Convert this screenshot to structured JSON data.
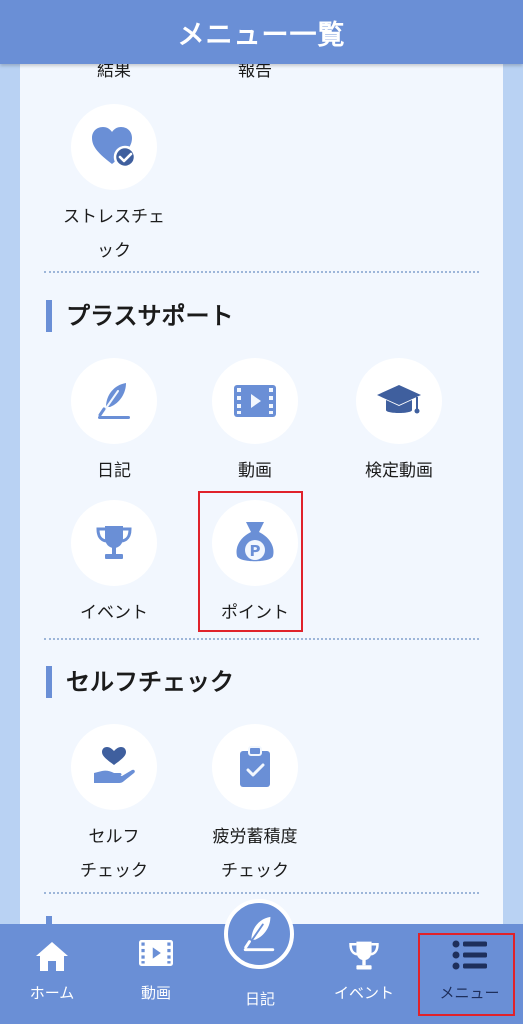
{
  "header": {
    "title": "メニュー一覧"
  },
  "top_partial": {
    "items": [
      "結果",
      "報告"
    ]
  },
  "stress": {
    "label": "ストレスチェ\nック"
  },
  "sections": [
    {
      "title": "プラスサポート",
      "items": [
        {
          "label": "日記",
          "icon": "feather-pen-icon"
        },
        {
          "label": "動画",
          "icon": "film-icon"
        },
        {
          "label": "検定動画",
          "icon": "graduation-cap-icon"
        },
        {
          "label": "イベント",
          "icon": "trophy-icon"
        },
        {
          "label": "ポイント",
          "icon": "money-bag-icon"
        }
      ]
    },
    {
      "title": "セルフチェック",
      "items": [
        {
          "label": "セルフ\nチェック",
          "icon": "heart-hand-icon"
        },
        {
          "label": "疲労蓄積度\nチェック",
          "icon": "clipboard-check-icon"
        }
      ]
    }
  ],
  "tabbar": {
    "items": [
      {
        "label": "ホーム",
        "icon": "home-icon"
      },
      {
        "label": "動画",
        "icon": "film-icon"
      },
      {
        "label": "日記",
        "icon": "feather-pen-icon"
      },
      {
        "label": "イベント",
        "icon": "trophy-icon"
      },
      {
        "label": "メニュー",
        "icon": "list-icon"
      }
    ]
  },
  "colors": {
    "primary": "#6a8fd6",
    "panel": "#f2f7fe",
    "background": "#b9d2f3",
    "highlight": "#e0222b"
  }
}
